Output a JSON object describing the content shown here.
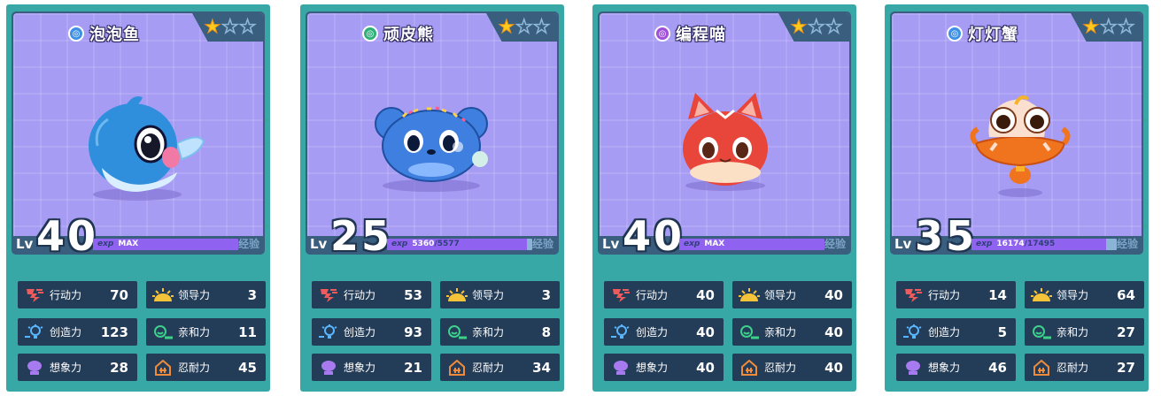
{
  "labels": {
    "lv": "Lv",
    "exp_tag": "exp",
    "exp_label": "经验"
  },
  "colors": {
    "card": "#37a8a6",
    "stage": "#a79cf4",
    "exp_fill": "#8f63f0",
    "star": "#ffcb1c"
  },
  "cards": [
    {
      "name": "泡泡鱼",
      "element_icon": "water-element-icon",
      "element_color": "#3e8fe6",
      "stars": 1,
      "stars_max": 3,
      "level": "40",
      "exp_text": "MAX",
      "exp_current": "",
      "exp_total": "",
      "exp_progress": 1.0,
      "pet": "blue-fish-pet",
      "stats": [
        {
          "icon": "action-icon",
          "label": "行动力",
          "value": "70"
        },
        {
          "icon": "leadership-icon",
          "label": "领导力",
          "value": "3"
        },
        {
          "icon": "creativity-icon",
          "label": "创造力",
          "value": "123"
        },
        {
          "icon": "affinity-icon",
          "label": "亲和力",
          "value": "11"
        },
        {
          "icon": "imagination-icon",
          "label": "想象力",
          "value": "28"
        },
        {
          "icon": "endurance-icon",
          "label": "忍耐力",
          "value": "45"
        }
      ]
    },
    {
      "name": "顽皮熊",
      "element_icon": "wind-element-icon",
      "element_color": "#2fb07a",
      "stars": 1,
      "stars_max": 3,
      "level": "25",
      "exp_text": "",
      "exp_current": "5360",
      "exp_total": "5577",
      "exp_progress": 0.961,
      "pet": "blue-bear-pet",
      "stats": [
        {
          "icon": "action-icon",
          "label": "行动力",
          "value": "53"
        },
        {
          "icon": "leadership-icon",
          "label": "领导力",
          "value": "3"
        },
        {
          "icon": "creativity-icon",
          "label": "创造力",
          "value": "93"
        },
        {
          "icon": "affinity-icon",
          "label": "亲和力",
          "value": "8"
        },
        {
          "icon": "imagination-icon",
          "label": "想象力",
          "value": "21"
        },
        {
          "icon": "endurance-icon",
          "label": "忍耐力",
          "value": "34"
        }
      ]
    },
    {
      "name": "编程喵",
      "element_icon": "magic-element-icon",
      "element_color": "#a04fd8",
      "stars": 1,
      "stars_max": 3,
      "level": "40",
      "exp_text": "MAX",
      "exp_current": "",
      "exp_total": "",
      "exp_progress": 1.0,
      "pet": "red-cat-pet",
      "stats": [
        {
          "icon": "action-icon",
          "label": "行动力",
          "value": "40"
        },
        {
          "icon": "leadership-icon",
          "label": "领导力",
          "value": "40"
        },
        {
          "icon": "creativity-icon",
          "label": "创造力",
          "value": "40"
        },
        {
          "icon": "affinity-icon",
          "label": "亲和力",
          "value": "40"
        },
        {
          "icon": "imagination-icon",
          "label": "想象力",
          "value": "40"
        },
        {
          "icon": "endurance-icon",
          "label": "忍耐力",
          "value": "40"
        }
      ]
    },
    {
      "name": "灯灯蟹",
      "element_icon": "water-element-icon",
      "element_color": "#3e8fe6",
      "stars": 1,
      "stars_max": 3,
      "level": "35",
      "exp_text": "",
      "exp_current": "16174",
      "exp_total": "17495",
      "exp_progress": 0.924,
      "pet": "orange-crab-pet",
      "stats": [
        {
          "icon": "action-icon",
          "label": "行动力",
          "value": "14"
        },
        {
          "icon": "leadership-icon",
          "label": "领导力",
          "value": "64"
        },
        {
          "icon": "creativity-icon",
          "label": "创造力",
          "value": "5"
        },
        {
          "icon": "affinity-icon",
          "label": "亲和力",
          "value": "27"
        },
        {
          "icon": "imagination-icon",
          "label": "想象力",
          "value": "46"
        },
        {
          "icon": "endurance-icon",
          "label": "忍耐力",
          "value": "27"
        }
      ]
    }
  ]
}
